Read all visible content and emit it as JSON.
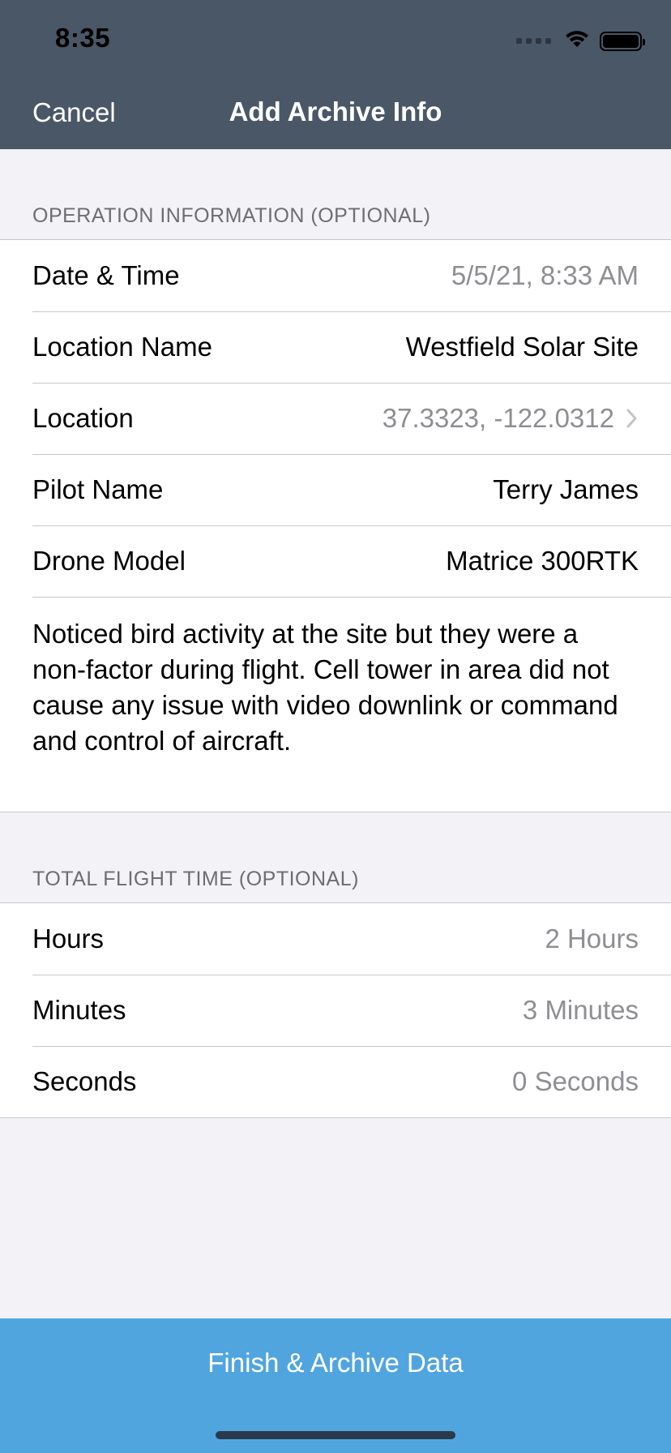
{
  "status_bar": {
    "time": "8:35"
  },
  "nav": {
    "cancel_label": "Cancel",
    "title": "Add Archive Info"
  },
  "operation_section": {
    "header": "OPERATION INFORMATION (OPTIONAL)",
    "rows": [
      {
        "label": "Date & Time",
        "value": "5/5/21, 8:33 AM"
      },
      {
        "label": "Location Name",
        "value": "Westfield Solar Site"
      },
      {
        "label": "Location",
        "value": "37.3323, -122.0312"
      },
      {
        "label": "Pilot Name",
        "value": "Terry James"
      },
      {
        "label": "Drone Model",
        "value": "Matrice 300RTK"
      }
    ],
    "notes": "Noticed bird activity at the site but they were a non-factor during flight. Cell tower in area did not cause any issue with video downlink or command and control of aircraft."
  },
  "flight_time_section": {
    "header": "TOTAL FLIGHT TIME (OPTIONAL)",
    "rows": [
      {
        "label": "Hours",
        "value": "2 Hours"
      },
      {
        "label": "Minutes",
        "value": "3 Minutes"
      },
      {
        "label": "Seconds",
        "value": "0 Seconds"
      }
    ]
  },
  "finish_button": {
    "label": "Finish & Archive Data"
  },
  "colors": {
    "nav_background": "#4a5766",
    "page_background": "#f2f2f7",
    "button_background": "#51a5df",
    "muted_text": "#8e8e93",
    "section_header_text": "#6d6d72"
  },
  "icons": {
    "wifi": "wifi-icon",
    "battery": "battery-icon",
    "signal": "cellular-signal-icon",
    "chevron": "chevron-right-icon"
  }
}
